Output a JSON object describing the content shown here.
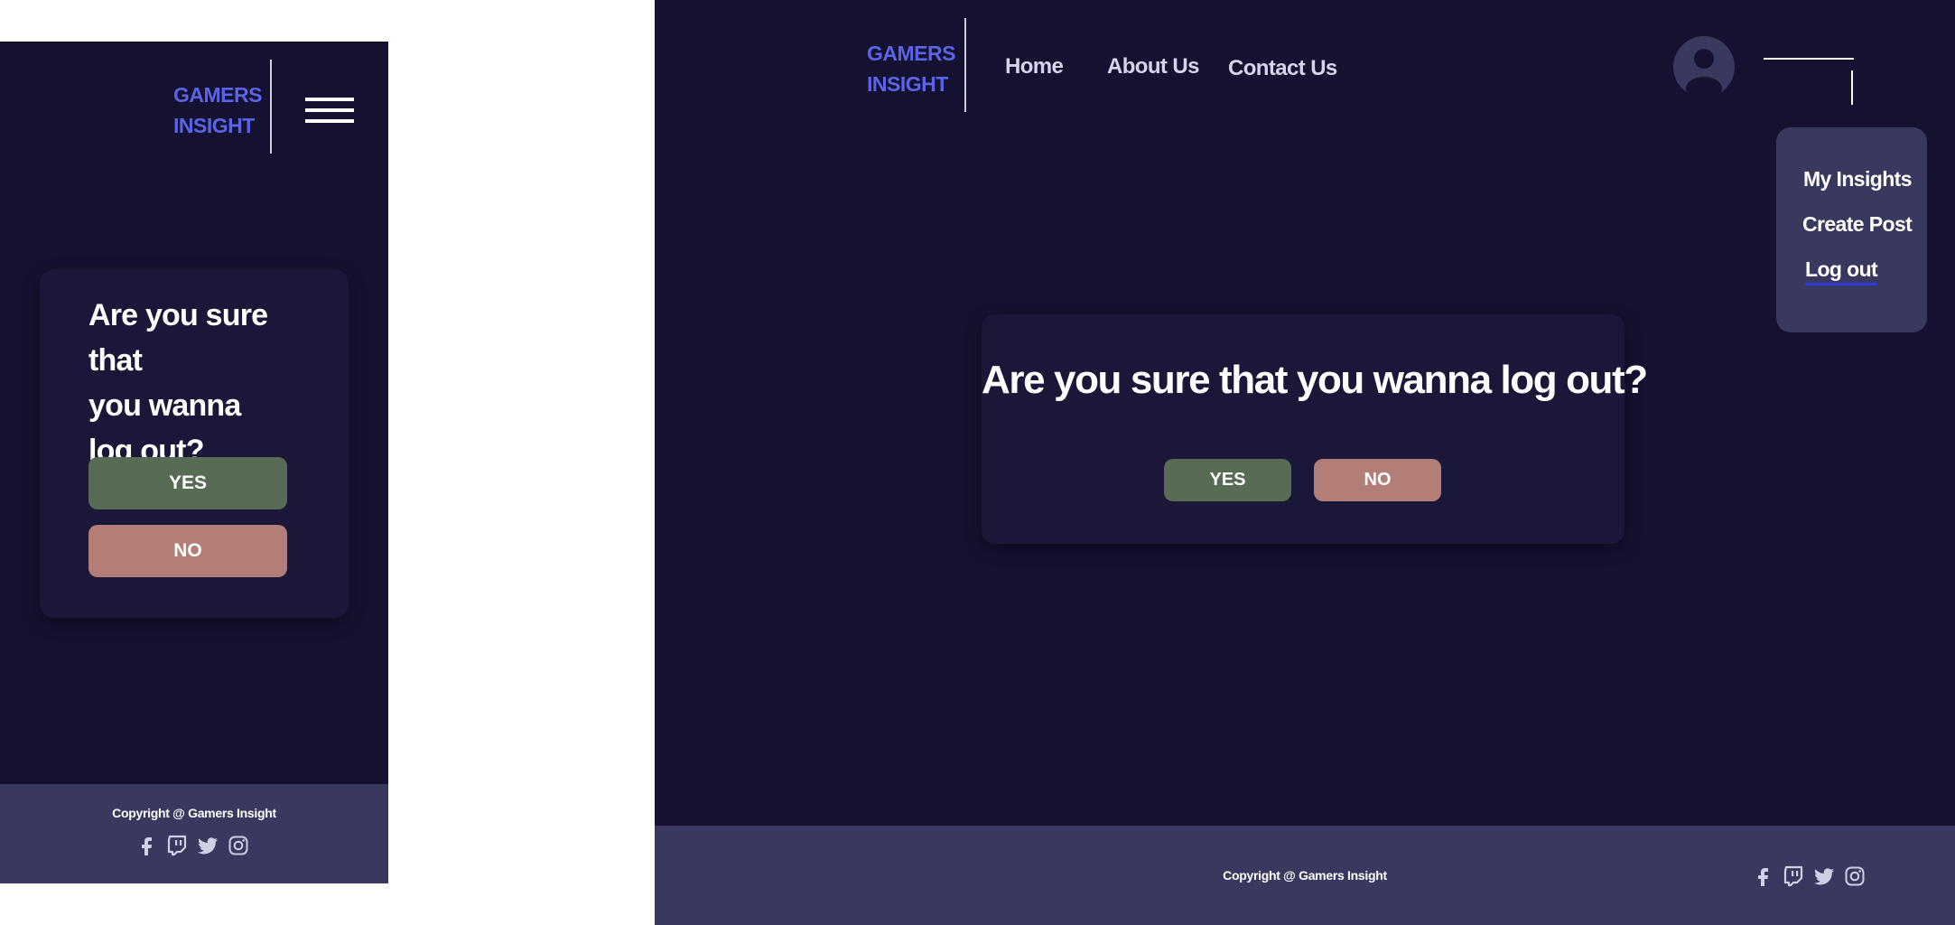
{
  "brand": {
    "line1": "GAMERS",
    "line2": "INSIGHT"
  },
  "nav": {
    "home": "Home",
    "about": "About Us",
    "contact": "Contact Us"
  },
  "user_menu": {
    "items": [
      {
        "label": "My Insights"
      },
      {
        "label": "Create Post"
      },
      {
        "label": "Log out",
        "active": true
      }
    ]
  },
  "dialog": {
    "question": "Are you sure that you wanna log out?",
    "mobile_lines": [
      "Are you sure that",
      "you wanna",
      "log out?"
    ],
    "yes_label": "YES",
    "no_label": "NO"
  },
  "footer": {
    "copyright": "Copyright @ Gamers Insight",
    "social_icons": [
      "facebook-icon",
      "twitch-icon",
      "twitter-icon",
      "instagram-icon"
    ]
  },
  "colors": {
    "page_bg": "#141230",
    "card_bg": "#1a1738",
    "footer_bg": "#393960",
    "brand": "#5b63e6",
    "yes": "#586b55",
    "no": "#b37d78",
    "underline": "#3039d8"
  }
}
